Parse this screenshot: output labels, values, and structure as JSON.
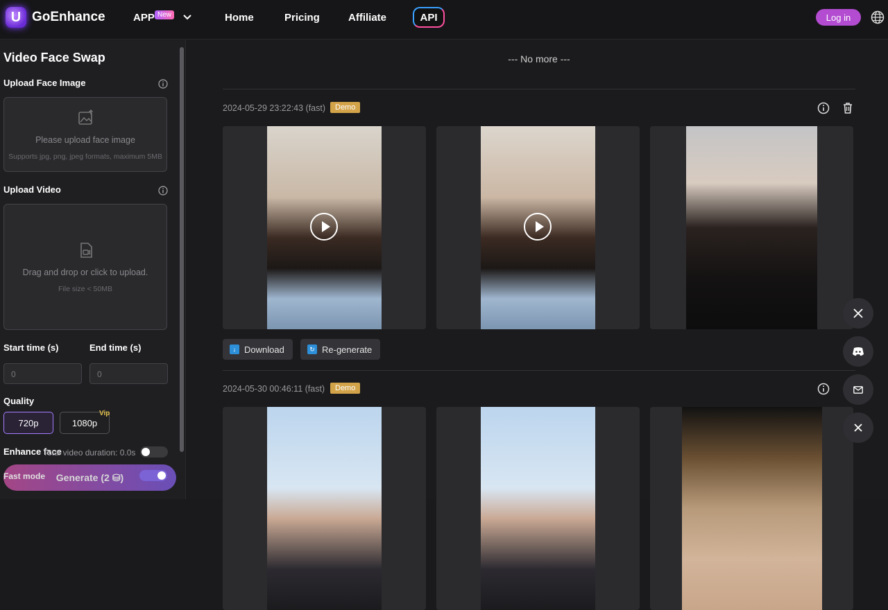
{
  "header": {
    "logo_text": "GoEnhance",
    "nav": {
      "app": "APP",
      "app_badge": "New",
      "home": "Home",
      "pricing": "Pricing",
      "affiliate": "Affiliate",
      "api": "API"
    },
    "login": "Log in"
  },
  "sidebar": {
    "title": "Video Face Swap",
    "upload_face_label": "Upload Face Image",
    "upload_face_text": "Please upload face image",
    "upload_face_sub": "Supports jpg, png, jpeg formats, maximum 5MB",
    "upload_video_label": "Upload Video",
    "upload_video_text": "Drag and drop or click to upload.",
    "upload_video_sub": "File size < 50MB",
    "start_label": "Start time (s)",
    "end_label": "End time (s)",
    "start_value": "0",
    "end_value": "0",
    "quality_label": "Quality",
    "quality_720": "720p",
    "quality_1080": "1080p",
    "vip": "Vip",
    "enhance_face": "Enhance face",
    "total_duration": "Total video duration: 0.0s",
    "fast_mode": "Fast mode",
    "generate": "Generate (2"
  },
  "main": {
    "no_more": "--- No more ---",
    "entries": [
      {
        "date": "2024-05-29 23:22:43 (fast)",
        "badge": "Demo"
      },
      {
        "date": "2024-05-30 00:46:11 (fast)",
        "badge": "Demo"
      }
    ],
    "download": "Download",
    "regenerate": "Re-generate"
  },
  "colors": {
    "accent": "#b34cd1",
    "demo_badge": "#d3a34a",
    "vip": "#e4c04c"
  }
}
